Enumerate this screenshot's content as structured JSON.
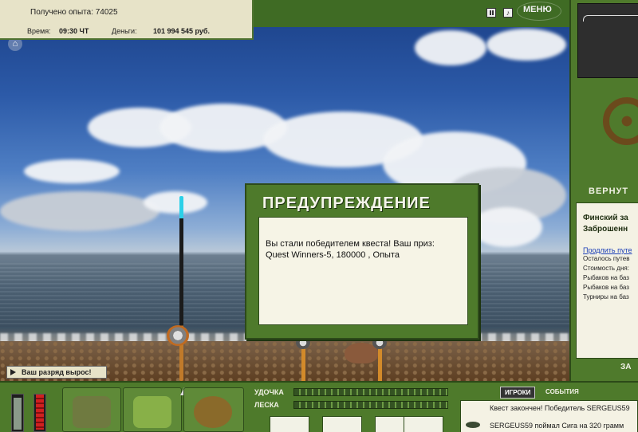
{
  "hud": {
    "experience": "Получено опыта: 74025",
    "time_label": "Время:",
    "time_value": "09:30 ЧТ",
    "money_label": "Деньги:",
    "money_value": "101 994 545 руб."
  },
  "topbar": {
    "menu_label": "МЕНЮ",
    "pause_icon": "pause-icon",
    "sound_icon": "sound-icon"
  },
  "dialog": {
    "title": "ПРЕДУПРЕЖДЕНИЕ",
    "lines": [
      "Вы стали победителем квеста! Ваш приз:",
      "Quest Winners-5, 180000 , Опыта"
    ]
  },
  "right_panel": {
    "return_label": "ВЕРНУТ",
    "location_title_1": "Финский за",
    "location_title_2": "Заброшенн",
    "extend_link": "Продлить путе",
    "lines": [
      "Осталось путев",
      "Стоимость дня:",
      "Рыбаков на баз",
      "Рыбаков на баз",
      "Турниры на баз"
    ],
    "bottom_label": "ЗА"
  },
  "notification": {
    "text": "Ваш разряд вырос!"
  },
  "tackle": {
    "rod_label": "УДОЧКА",
    "line_label": "ЛЕСКА"
  },
  "chat": {
    "tab_players": "ИГРОКИ",
    "tab_events": "СОБЫТИЯ",
    "messages": [
      "Квест закончен! Победитель SERGEUS59",
      "SERGEUS59 поймал Сига на 320 грамм"
    ]
  },
  "colors": {
    "panel_green": "#4e7a2b",
    "info_bg": "#e7e3c8",
    "link_blue": "#1c3fb8"
  }
}
